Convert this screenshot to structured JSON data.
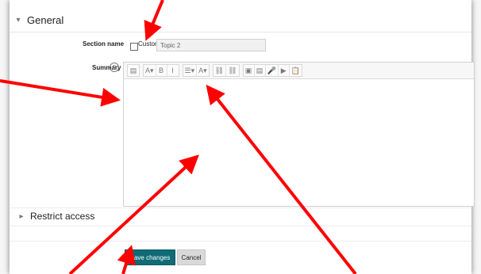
{
  "section": {
    "general_title": "General",
    "section_name_label": "Section name",
    "custom_label": "Custom",
    "section_name_value": "Topic 2",
    "summary_label": "Summary",
    "help_symbol": "?"
  },
  "editor": {
    "toolbar": [
      {
        "name": "toggle-toolbar-icon",
        "glyph": "▤"
      },
      {
        "name": "heading-icon",
        "glyph": "A▾"
      },
      {
        "name": "bold-icon",
        "glyph": "B"
      },
      {
        "name": "italic-icon",
        "glyph": "I"
      },
      {
        "name": "list-icon",
        "glyph": "☰▾"
      },
      {
        "name": "text-color-icon",
        "glyph": "A▾"
      },
      {
        "name": "link-icon",
        "glyph": "⛓"
      },
      {
        "name": "unlink-icon",
        "glyph": "⛓"
      },
      {
        "name": "image-icon",
        "glyph": "▣"
      },
      {
        "name": "media-icon",
        "glyph": "▤"
      },
      {
        "name": "record-audio-icon",
        "glyph": "🎤"
      },
      {
        "name": "record-video-icon",
        "glyph": "▶"
      },
      {
        "name": "manage-files-icon",
        "glyph": "📋"
      }
    ]
  },
  "restrict": {
    "title": "Restrict access"
  },
  "actions": {
    "save_label": "Save changes",
    "cancel_label": "Cancel"
  },
  "colors": {
    "primary": "#0f6b76",
    "annotation_arrow": "#ff0000"
  }
}
